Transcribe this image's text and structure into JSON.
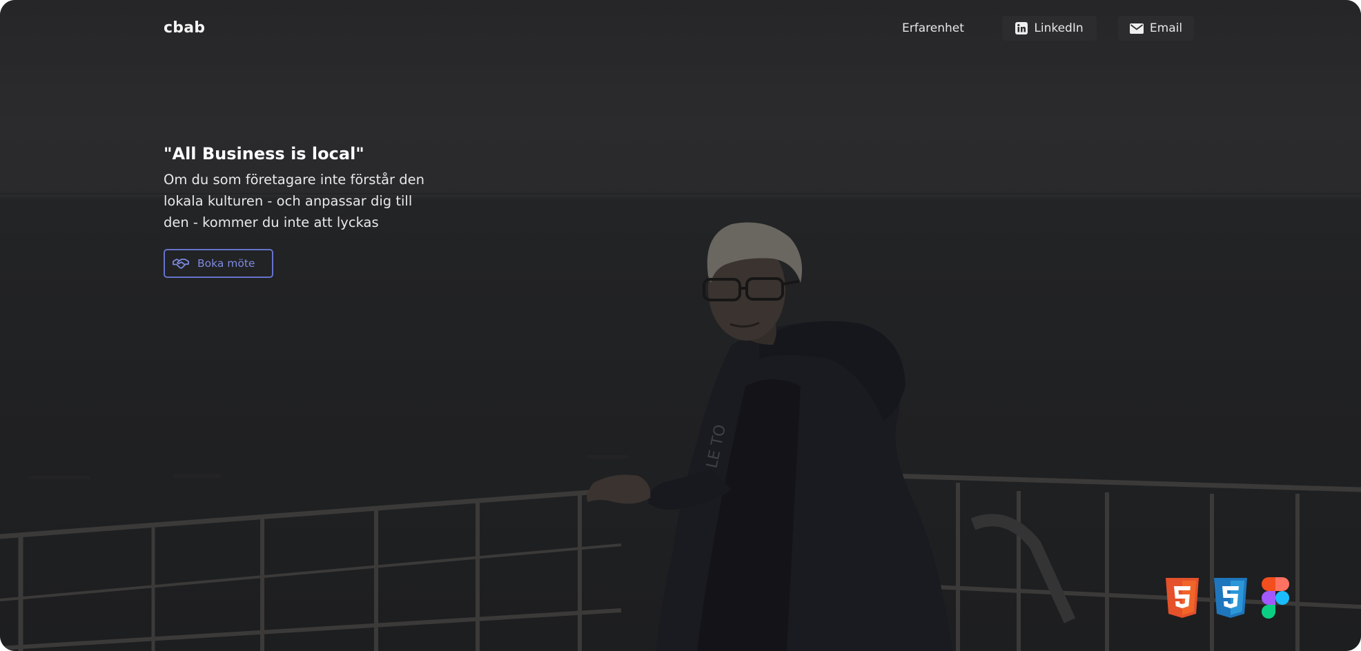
{
  "header": {
    "logo": "cbab",
    "nav": {
      "experience_label": "Erfarenhet",
      "linkedin_label": "LinkedIn",
      "email_label": "Email"
    }
  },
  "hero": {
    "quote": "\"All Business is local\"",
    "lines": [
      "Om du som företagare inte förstår den",
      "lokala kulturen - och anpassar dig till",
      "den - kommer du inte att lyckas"
    ],
    "cta_label": "Boka möte"
  },
  "tech_icons": [
    "html5-icon",
    "css3-icon",
    "figma-icon"
  ],
  "colors": {
    "accent": "#6673cc",
    "html5": "#e4512b",
    "css3": "#1f76bc",
    "background": "#1f1f21"
  }
}
